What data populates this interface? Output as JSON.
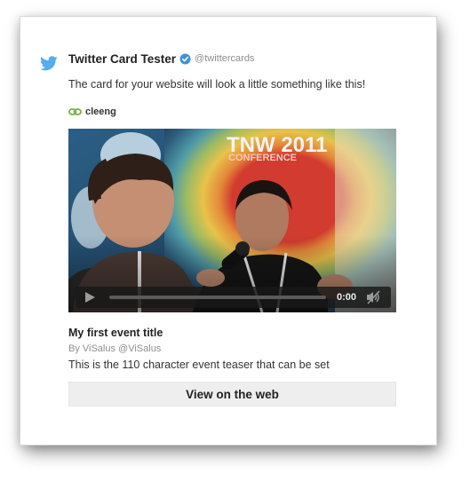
{
  "header": {
    "title": "Twitter Card Tester",
    "handle": "@twittercards"
  },
  "subtitle": "The card for your website will look a little something like this!",
  "brand": {
    "name": "cleeng"
  },
  "video": {
    "banner_line1": "TNW 2011",
    "banner_line2": "CONFERENCE",
    "time": "0:00",
    "progress": 0
  },
  "event": {
    "title": "My first event title",
    "byline": "By ViSalus @ViSalus",
    "description": "This is the 110 character event teaser that can be set"
  },
  "cta": {
    "label": "View on the web"
  },
  "colors": {
    "twitter_blue": "#55acee",
    "verified_blue": "#3b94d9",
    "brand_green": "#7ab648"
  },
  "icons": [
    "twitter-bird-icon",
    "verified-badge-icon",
    "cleeng-logo-icon",
    "play-icon",
    "volume-muted-icon"
  ]
}
